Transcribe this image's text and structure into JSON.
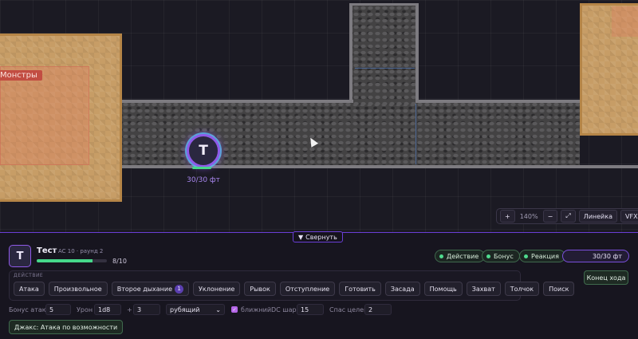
{
  "map": {
    "zone_label": "Монстры",
    "token": {
      "initial": "T",
      "movement": "30/30 фт"
    },
    "zoom": {
      "plus": "+",
      "value": "140%",
      "minus": "−",
      "ruler": "Линейка",
      "vfx": "VFX"
    }
  },
  "panel": {
    "collapse_label": "Свернуть",
    "character": {
      "initial": "T",
      "name": "Тест",
      "meta": "AC 10 · раунд 2",
      "hp_text": "8/10",
      "hp_fraction": 0.8
    },
    "economy": [
      {
        "label": "Действие"
      },
      {
        "label": "Бонус"
      },
      {
        "label": "Реакция"
      }
    ],
    "movement": "30/30 фт",
    "end_turn": "Конец хода",
    "actions_heading": "ДЕЙСТВИЕ",
    "actions": [
      {
        "label": "Атака"
      },
      {
        "label": "Произвольное"
      },
      {
        "label": "Второе дыхание",
        "badge": "1"
      },
      {
        "label": "Уклонение"
      },
      {
        "label": "Рывок"
      },
      {
        "label": "Отступление"
      },
      {
        "label": "Готовить"
      },
      {
        "label": "Засада"
      },
      {
        "label": "Помощь"
      },
      {
        "label": "Захват"
      },
      {
        "label": "Толчок"
      },
      {
        "label": "Поиск"
      }
    ],
    "fields": {
      "attack_bonus_label": "Бонус атаки",
      "attack_bonus_value": "5",
      "damage_label": "Урон",
      "damage_value": "1d8",
      "plus_label": "+",
      "damage_bonus_value": "3",
      "damage_type": "рубящий",
      "melee_label": "ближний",
      "dc_label": "DC шара",
      "dc_value": "15",
      "targets_label": "Спас целей",
      "targets_value": "2"
    },
    "reaction_button": "Джакс: Атака по возможности"
  }
}
